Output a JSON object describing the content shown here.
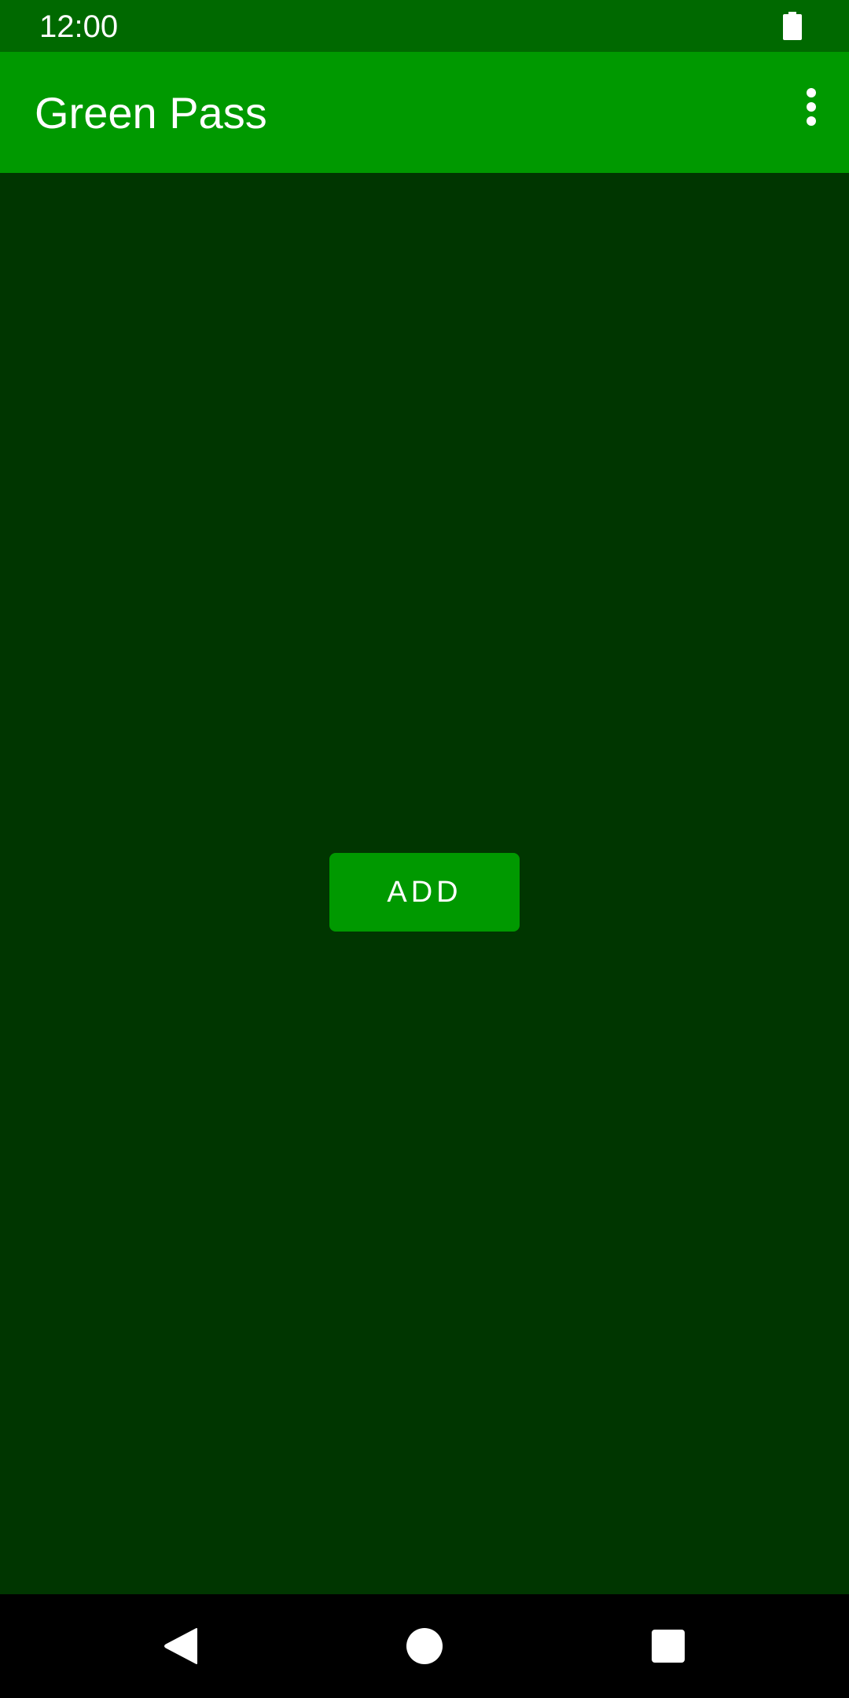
{
  "status_bar": {
    "time": "12:00",
    "battery_icon": "battery-full-icon"
  },
  "app_bar": {
    "title": "Green Pass",
    "menu_icon": "more-vert-icon"
  },
  "main": {
    "add_button_label": "ADD"
  },
  "nav_bar": {
    "back_icon": "back-triangle-icon",
    "home_icon": "home-circle-icon",
    "recents_icon": "recents-square-icon"
  },
  "colors": {
    "status_bar": "#006900",
    "app_bar": "#009900",
    "background": "#003600",
    "button": "#009900",
    "nav_bar": "#000000",
    "text": "#ffffff"
  }
}
